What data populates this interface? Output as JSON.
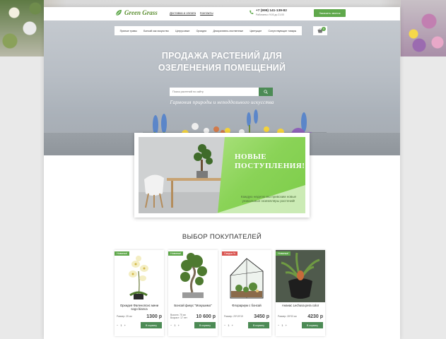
{
  "colors": {
    "accent_green": "#5fa84b",
    "dark_green": "#4c8b55",
    "badge_new": "#5fa84b",
    "badge_sale": "#d9534f"
  },
  "header": {
    "logo_text": "Green Grass",
    "links": [
      "Доставка и оплата",
      "Контакты"
    ],
    "phone": "+7 (999) 141-139-82",
    "hours": "Работаем с 9:00 до 21:00",
    "callback_label": "Заказать звонок"
  },
  "nav": {
    "items": [
      "Пряные травы",
      "Бонсай как искусство",
      "Цитрусовые",
      "Орхидеи",
      "Декоративно-лиственные",
      "Цветущие",
      "Сопутствующие товары"
    ],
    "cart_count": "0"
  },
  "hero": {
    "title_line1": "ПРОДАЖА РАСТЕНИЙ ДЛЯ",
    "title_line2": "ОЗЕЛЕНЕНИЯ ПОМЕЩЕНИЙ",
    "search_placeholder": "Поиск растений по сайту",
    "tagline": "Гармония природы и неподдельного искусства"
  },
  "promo": {
    "title_line1": "НОВЫЕ",
    "title_line2": "ПОСТУПЛЕНИЯ!",
    "text": "Каждую неделю мы привозим новые уникальные экземпляры растений!"
  },
  "section_title": "ВЫБОР ПОКУПАТЕЛЕЙ",
  "products": [
    {
      "badge": "Новинка!",
      "badge_type": "new",
      "name": "Орхидея Фаленопсис мини sogo bianca",
      "spec1": "Размер: 25 см",
      "spec2": "",
      "price": "1300 р",
      "qty": "1",
      "cart_label": "В корзину"
    },
    {
      "badge": "Новинка!",
      "badge_type": "new",
      "name": "Бонсай фикус \"Мокушимо\"",
      "spec1": "Высота: 75 см",
      "spec2": "Возраст: 17 лет",
      "price": "10 600 р",
      "qty": "1",
      "cart_label": "В корзину"
    },
    {
      "badge": "Скидка %",
      "badge_type": "sale",
      "name": "Флорариум с бонсай",
      "spec1": "Размер: 29*19*19",
      "spec2": "",
      "price": "3450 р",
      "qty": "1",
      "cart_label": "В корзину"
    },
    {
      "badge": "Новинка!",
      "badge_type": "new",
      "name": "Ананас Lechusa pera color",
      "spec1": "Размер: 28*33 см",
      "spec2": "",
      "price": "4230 р",
      "qty": "1",
      "cart_label": "В корзину"
    }
  ],
  "stepper": {
    "minus": "−",
    "plus": "+"
  }
}
